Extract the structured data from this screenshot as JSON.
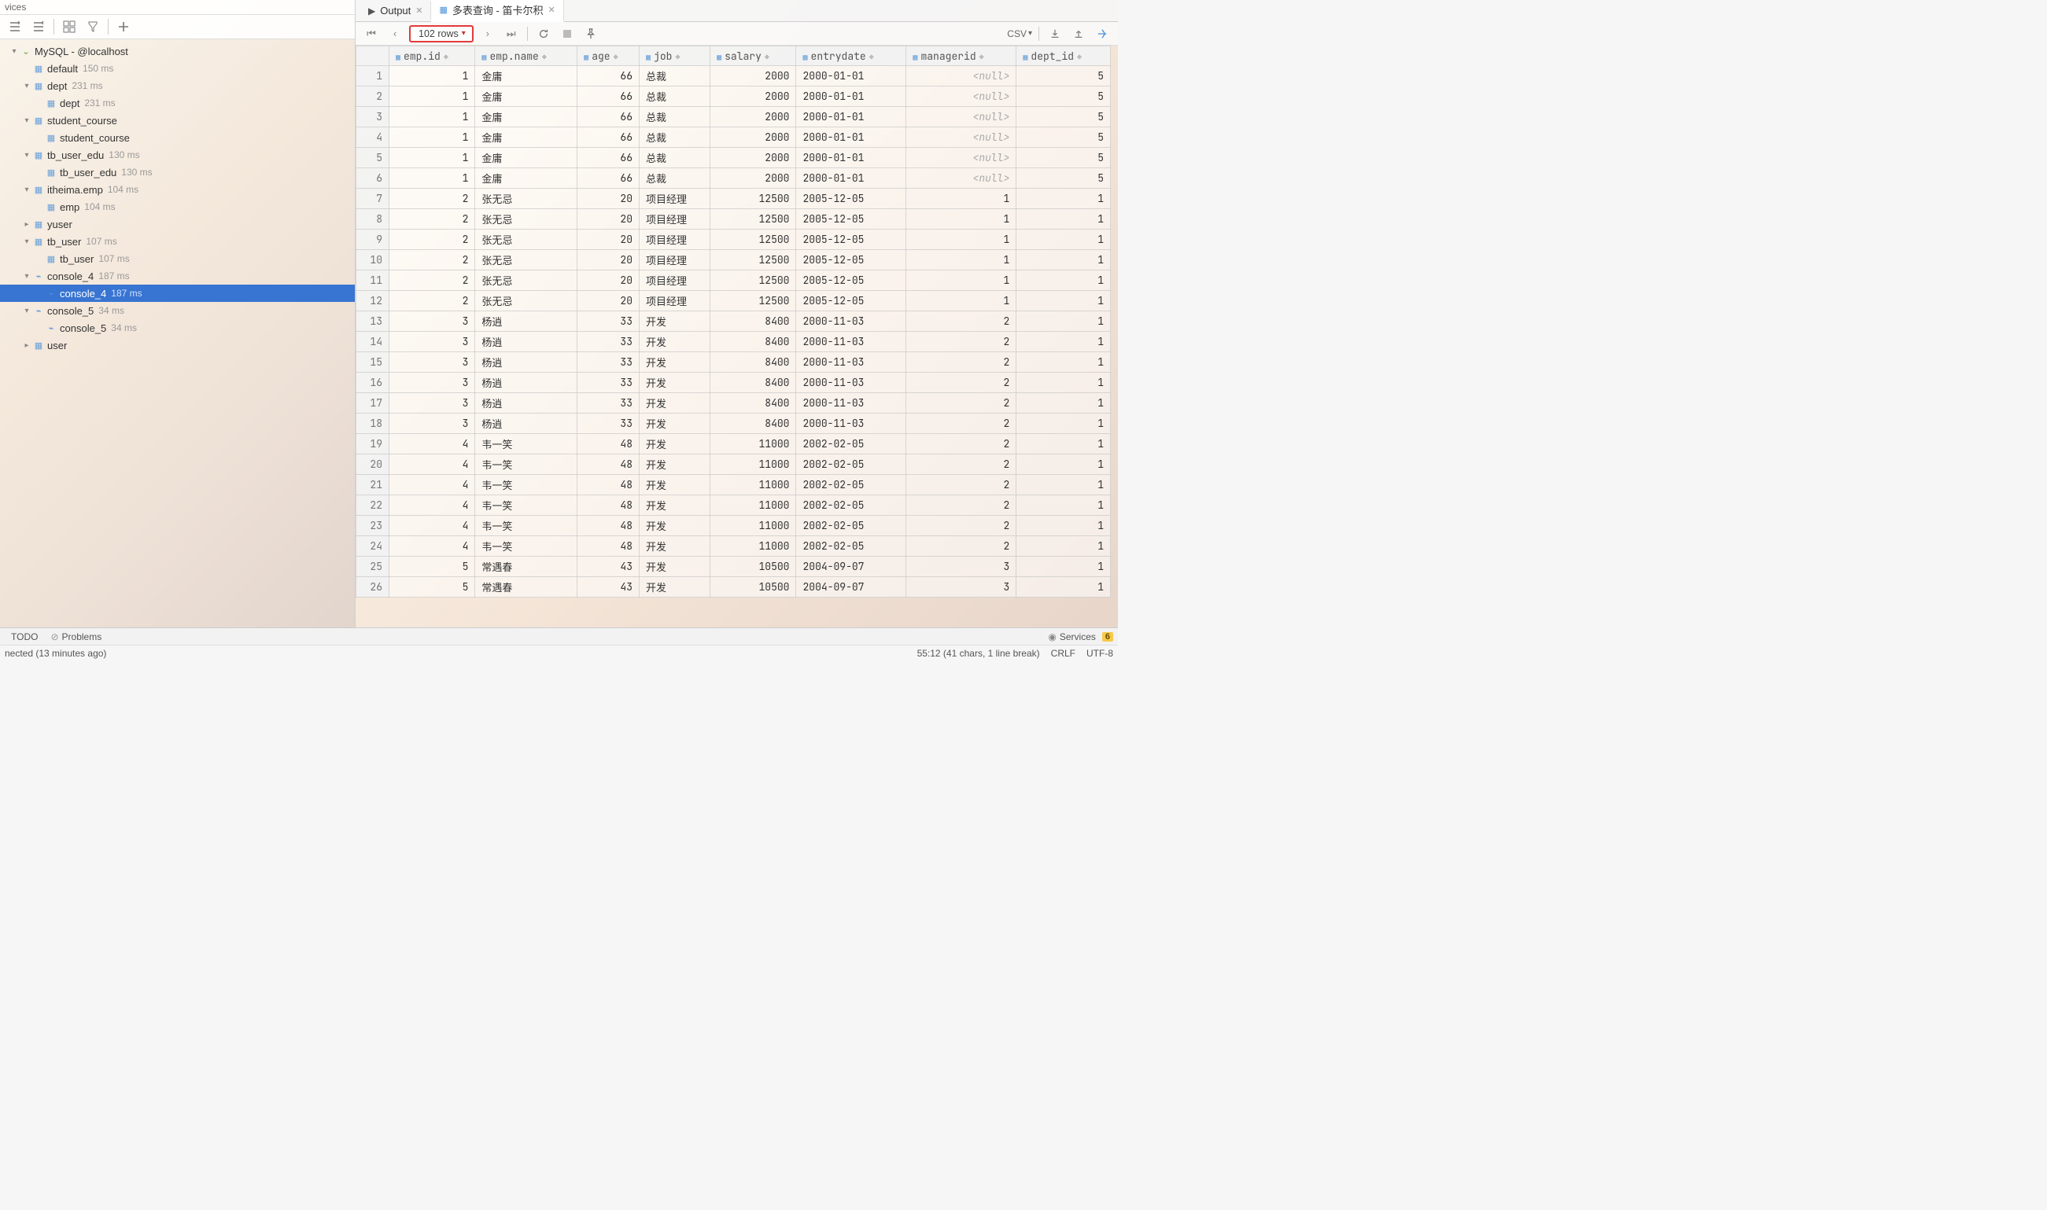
{
  "toolwindow_title": "vices",
  "tree": {
    "root": {
      "label": "MySQL - @localhost"
    },
    "items": [
      {
        "label": "default",
        "time": "150 ms"
      },
      {
        "label": "dept",
        "time": "231 ms",
        "child": {
          "label": "dept",
          "time": "231 ms"
        }
      },
      {
        "label": "student_course",
        "time": "",
        "child": {
          "label": "student_course",
          "time": ""
        }
      },
      {
        "label": "tb_user_edu",
        "time": "130 ms",
        "child": {
          "label": "tb_user_edu",
          "time": "130 ms"
        }
      },
      {
        "label": "itheima.emp",
        "time": "104 ms",
        "child": {
          "label": "emp",
          "time": "104 ms"
        }
      },
      {
        "label": "yuser",
        "time": ""
      },
      {
        "label": "tb_user",
        "time": "107 ms",
        "child": {
          "label": "tb_user",
          "time": "107 ms"
        }
      },
      {
        "label": "console_4",
        "time": "187 ms",
        "child": {
          "label": "console_4",
          "time": "187 ms"
        }
      },
      {
        "label": "console_5",
        "time": "34 ms",
        "child": {
          "label": "console_5",
          "time": "34 ms"
        }
      },
      {
        "label": "user",
        "time": ""
      }
    ]
  },
  "tabs": {
    "output": "Output",
    "query": "多表查询 - 笛卡尔积"
  },
  "result_toolbar": {
    "rows_label": "102 rows",
    "csv_label": "CSV"
  },
  "columns": [
    "emp.id",
    "emp.name",
    "age",
    "job",
    "salary",
    "entrydate",
    "managerid",
    "dept_id"
  ],
  "rows": [
    [
      1,
      "金庸",
      66,
      "总裁",
      2000,
      "2000-01-01",
      null,
      5
    ],
    [
      1,
      "金庸",
      66,
      "总裁",
      2000,
      "2000-01-01",
      null,
      5
    ],
    [
      1,
      "金庸",
      66,
      "总裁",
      2000,
      "2000-01-01",
      null,
      5
    ],
    [
      1,
      "金庸",
      66,
      "总裁",
      2000,
      "2000-01-01",
      null,
      5
    ],
    [
      1,
      "金庸",
      66,
      "总裁",
      2000,
      "2000-01-01",
      null,
      5
    ],
    [
      1,
      "金庸",
      66,
      "总裁",
      2000,
      "2000-01-01",
      null,
      5
    ],
    [
      2,
      "张无忌",
      20,
      "项目经理",
      12500,
      "2005-12-05",
      1,
      1
    ],
    [
      2,
      "张无忌",
      20,
      "项目经理",
      12500,
      "2005-12-05",
      1,
      1
    ],
    [
      2,
      "张无忌",
      20,
      "项目经理",
      12500,
      "2005-12-05",
      1,
      1
    ],
    [
      2,
      "张无忌",
      20,
      "项目经理",
      12500,
      "2005-12-05",
      1,
      1
    ],
    [
      2,
      "张无忌",
      20,
      "项目经理",
      12500,
      "2005-12-05",
      1,
      1
    ],
    [
      2,
      "张无忌",
      20,
      "项目经理",
      12500,
      "2005-12-05",
      1,
      1
    ],
    [
      3,
      "杨逍",
      33,
      "开发",
      8400,
      "2000-11-03",
      2,
      1
    ],
    [
      3,
      "杨逍",
      33,
      "开发",
      8400,
      "2000-11-03",
      2,
      1
    ],
    [
      3,
      "杨逍",
      33,
      "开发",
      8400,
      "2000-11-03",
      2,
      1
    ],
    [
      3,
      "杨逍",
      33,
      "开发",
      8400,
      "2000-11-03",
      2,
      1
    ],
    [
      3,
      "杨逍",
      33,
      "开发",
      8400,
      "2000-11-03",
      2,
      1
    ],
    [
      3,
      "杨逍",
      33,
      "开发",
      8400,
      "2000-11-03",
      2,
      1
    ],
    [
      4,
      "韦一笑",
      48,
      "开发",
      11000,
      "2002-02-05",
      2,
      1
    ],
    [
      4,
      "韦一笑",
      48,
      "开发",
      11000,
      "2002-02-05",
      2,
      1
    ],
    [
      4,
      "韦一笑",
      48,
      "开发",
      11000,
      "2002-02-05",
      2,
      1
    ],
    [
      4,
      "韦一笑",
      48,
      "开发",
      11000,
      "2002-02-05",
      2,
      1
    ],
    [
      4,
      "韦一笑",
      48,
      "开发",
      11000,
      "2002-02-05",
      2,
      1
    ],
    [
      4,
      "韦一笑",
      48,
      "开发",
      11000,
      "2002-02-05",
      2,
      1
    ],
    [
      5,
      "常遇春",
      43,
      "开发",
      10500,
      "2004-09-07",
      3,
      1
    ],
    [
      5,
      "常遇春",
      43,
      "开发",
      10500,
      "2004-09-07",
      3,
      1
    ]
  ],
  "bottom": {
    "todo": "TODO",
    "problems": "Problems",
    "services": "Services",
    "badge": "6"
  },
  "status": {
    "connected": "nected (13 minutes ago)",
    "pos": "55:12 (41 chars, 1 line break)",
    "eol": "CRLF",
    "enc": "UTF-8"
  }
}
